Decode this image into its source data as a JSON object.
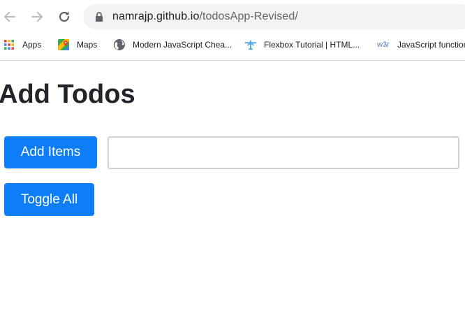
{
  "browser": {
    "url_host": "namrajp.github.io",
    "url_path": "/todosApp-Revised/",
    "nav": {
      "back_icon": "back-arrow-icon",
      "forward_icon": "forward-arrow-icon",
      "reload_icon": "reload-icon"
    },
    "bookmarks": [
      {
        "label": "Apps",
        "icon": "apps-grid-icon"
      },
      {
        "label": "Maps",
        "icon": "maps-icon"
      },
      {
        "label": "Modern JavaScript Chea...",
        "icon": "globe-icon"
      },
      {
        "label": "Flexbox Tutorial | HTML...",
        "icon": "flexbox-icon"
      },
      {
        "label": "JavaScript function",
        "icon": "w3r-icon",
        "icon_text": "w3r"
      }
    ]
  },
  "page": {
    "title": "Add Todos",
    "add_button_label": "Add Items",
    "toggle_button_label": "Toggle All",
    "todo_input_value": "",
    "todo_input_placeholder": ""
  },
  "colors": {
    "primary_button": "#0d7ef8",
    "heading_text": "#212529",
    "input_border": "#cfd2d6"
  }
}
